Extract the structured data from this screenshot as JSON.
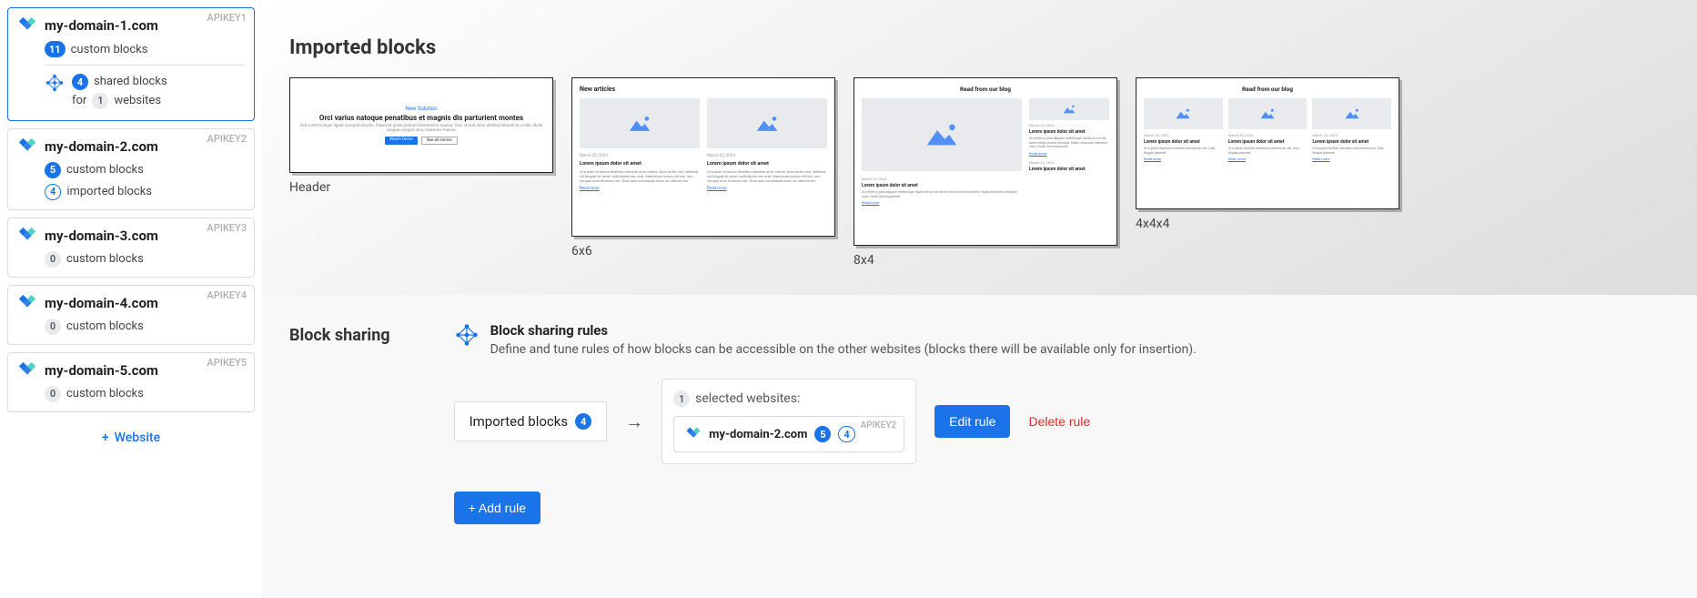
{
  "sidebar": {
    "domains": [
      {
        "api_key": "APIKEY1",
        "name": "my-domain-1.com",
        "custom_count": "11",
        "custom_label": "custom blocks",
        "selected": true,
        "shared": {
          "count": "4",
          "shared_label": "shared blocks",
          "for_label": "for",
          "websites_count": "1",
          "websites_label": "websites"
        }
      },
      {
        "api_key": "APIKEY2",
        "name": "my-domain-2.com",
        "custom_count": "5",
        "custom_label": "custom blocks",
        "imported_count": "4",
        "imported_label": "imported blocks"
      },
      {
        "api_key": "APIKEY3",
        "name": "my-domain-3.com",
        "custom_count": "0",
        "custom_label": "custom blocks"
      },
      {
        "api_key": "APIKEY4",
        "name": "my-domain-4.com",
        "custom_count": "0",
        "custom_label": "custom blocks"
      },
      {
        "api_key": "APIKEY5",
        "name": "my-domain-5.com",
        "custom_count": "0",
        "custom_label": "custom blocks"
      }
    ],
    "add_website": "Website"
  },
  "imported": {
    "title": "Imported blocks",
    "labels": [
      "Header",
      "6x6",
      "8x4",
      "4x4x4"
    ],
    "header_block": {
      "tiny": "New Solution",
      "title": "Orci varius natoque penatibus et magnis dis parturient montes",
      "sub": "Sed a elit tristique ligula suscipit lobortis. Praesent porta pretium hendrerit in massa. Cras id erat dolor eleifend blandit et a nibh. Nulla congue congue arcu, maximus massa.",
      "btn1": "Watch Demo",
      "btn2": "See all stories"
    },
    "article_block": {
      "title": "New articles",
      "date": "March 20, 2024",
      "headline": "Lorem ipsum dolor sit amet",
      "text": "Ut a justo in lectus facilisis molestie ut ac metus. Duis tortor orci, eleifend vel feugiat sit amet, sollicitudin nec erat. Maecenas luctus elit nisl, nec congue eros rhoncus nec. Duis quis consequat risus, ac ultrices leo.",
      "read_more": "Read more"
    },
    "blog_block": {
      "title": "Read from our blog",
      "date": "March 23, 2024",
      "headline": "Lorem ipsum dolor sit amet",
      "text": "Ut a felis in justo aliquam scelerisque. Nulla vel orci sit amet metus viverra convallis. Nulla commodo interdum nunc. Nulla viverra placerat.",
      "read_more": "Read more"
    },
    "blog3_block": {
      "title": "Read from our blog",
      "date": "March 20, 2024",
      "headline": "Lorem ipsum dolor sit amet",
      "text": "Ut a ipsum facilisis hendrerit euismod ac nisi. Duis feugiat placerat.",
      "read_more": "Read more"
    }
  },
  "sharing": {
    "title": "Block sharing",
    "rules_title": "Block sharing rules",
    "rules_desc": "Define and tune rules of how blocks can be accessible on the other websites (blocks there will be available only for insertion).",
    "imported_chip": {
      "label": "Imported blocks",
      "count": "4"
    },
    "selected": {
      "count": "1",
      "label": "selected websites:",
      "domain": {
        "api_key": "APIKEY2",
        "name": "my-domain-2.com",
        "custom": "5",
        "imported": "4"
      }
    },
    "edit_rule": "Edit rule",
    "delete_rule": "Delete rule",
    "add_rule": "+ Add rule"
  }
}
